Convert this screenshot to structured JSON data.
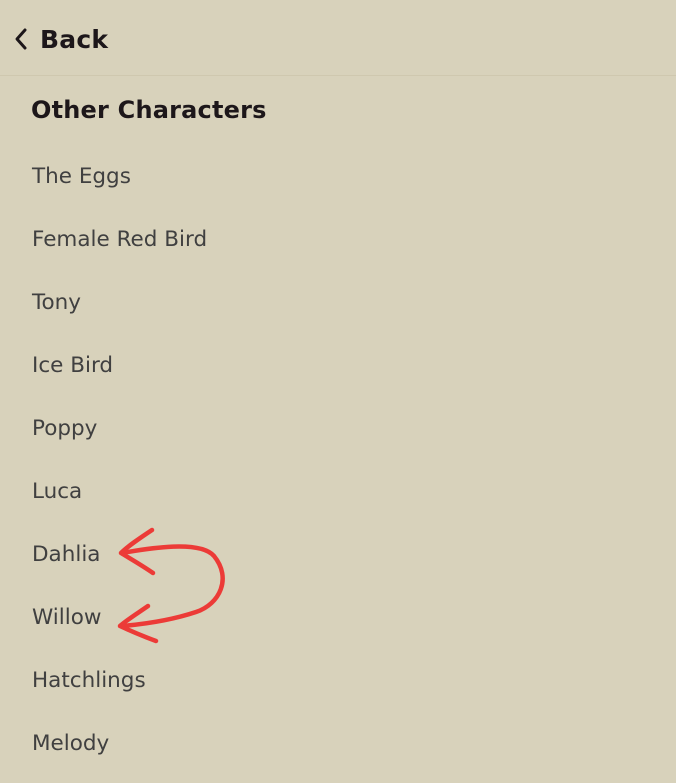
{
  "header": {
    "back_label": "Back",
    "back_icon": "chevron-left-icon"
  },
  "section": {
    "title": "Other Characters"
  },
  "characters": [
    "The Eggs",
    "Female Red Bird",
    "Tony",
    "Ice Bird",
    "Poppy",
    "Luca",
    "Dahlia",
    "Willow",
    "Hatchlings",
    "Melody"
  ],
  "annotation": {
    "type": "hand-drawn-arrows",
    "color": "#ec3b37",
    "points_to": [
      "Dahlia",
      "Willow"
    ]
  },
  "colors": {
    "background": "#d8d2bb",
    "heading": "#1d171a",
    "item_text": "#404040"
  }
}
